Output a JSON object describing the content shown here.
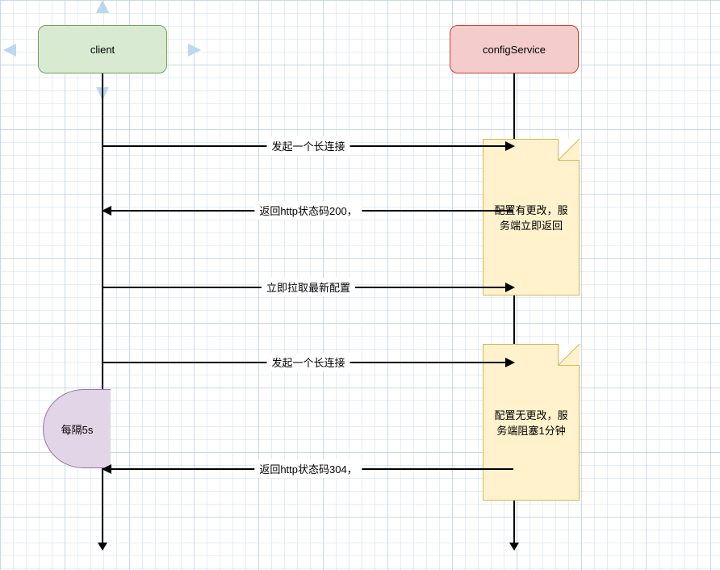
{
  "participants": {
    "client": {
      "label": "client"
    },
    "configService": {
      "label": "configService"
    }
  },
  "messages": {
    "m1": "发起一个长连接",
    "m2": "返回http状态码200，",
    "m3": "立即拉取最新配置",
    "m4": "发起一个长连接",
    "m5": "返回http状态码304，"
  },
  "notes": {
    "n1": "配置有更改，服务端立即返回",
    "n2": "配置无更改，服务端阻塞1分钟"
  },
  "loopBadge": "每隔5s",
  "colors": {
    "clientFill": "#d9ead3",
    "clientBorder": "#6aa84f",
    "configFill": "#f4cccc",
    "configBorder": "#cc4125",
    "noteFill": "#fff2cc",
    "noteBorder": "#d6b656",
    "badgeFill": "#e1d5e7",
    "badgeBorder": "#9673a6"
  },
  "chart_data": {
    "type": "sequence-diagram",
    "participants": [
      "client",
      "configService"
    ],
    "messages": [
      {
        "from": "client",
        "to": "configService",
        "label": "发起一个长连接"
      },
      {
        "from": "configService",
        "to": "client",
        "label": "返回http状态码200，",
        "note": "配置有更改，服务端立即返回"
      },
      {
        "from": "client",
        "to": "configService",
        "label": "立即拉取最新配置"
      },
      {
        "from": "client",
        "to": "configService",
        "label": "发起一个长连接"
      },
      {
        "from": "configService",
        "to": "client",
        "label": "返回http状态码304，",
        "note": "配置无更改，服务端阻塞1分钟"
      }
    ],
    "loop": {
      "label": "每隔5s",
      "covers": [
        "发起一个长连接",
        "返回http状态码304，"
      ]
    }
  }
}
